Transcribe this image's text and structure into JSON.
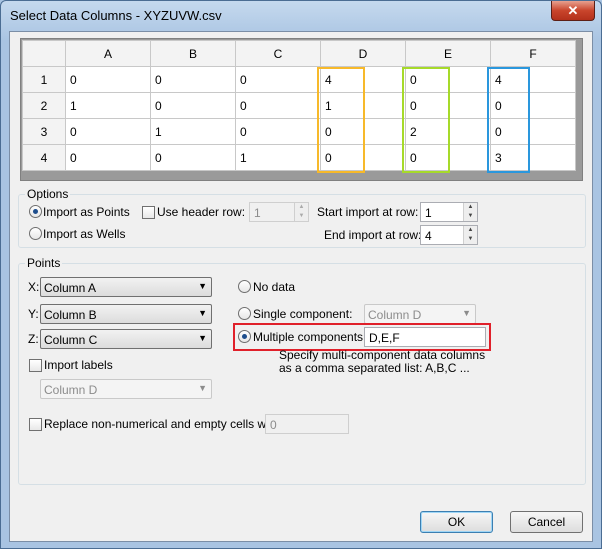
{
  "window": {
    "title": "Select Data Columns - XYZUVW.csv",
    "close_label": "✕"
  },
  "grid": {
    "columns": [
      "A",
      "B",
      "C",
      "D",
      "E",
      "F"
    ],
    "rows": [
      {
        "label": "1",
        "cells": [
          "0",
          "0",
          "0",
          "4",
          "0",
          "4"
        ]
      },
      {
        "label": "2",
        "cells": [
          "1",
          "0",
          "0",
          "1",
          "0",
          "0"
        ]
      },
      {
        "label": "3",
        "cells": [
          "0",
          "1",
          "0",
          "0",
          "2",
          "0"
        ]
      },
      {
        "label": "4",
        "cells": [
          "0",
          "0",
          "1",
          "0",
          "0",
          "3"
        ]
      }
    ],
    "highlight_colors": {
      "D": "#f7b92a",
      "E": "#a6da2a",
      "F": "#2a97dd"
    }
  },
  "options": {
    "group_label": "Options",
    "import_as_points": "Import as Points",
    "import_as_wells": "Import as Wells",
    "use_header_row": "Use header row:",
    "header_row_value": "1",
    "start_import_label": "Start import at row:",
    "start_import_value": "1",
    "end_import_label": "End import at row:",
    "end_import_value": "4"
  },
  "points": {
    "group_label": "Points",
    "x_label": "X:",
    "x_value": "Column A",
    "y_label": "Y:",
    "y_value": "Column B",
    "z_label": "Z:",
    "z_value": "Column C",
    "no_data": "No data",
    "single_component": "Single component:",
    "single_component_value": "Column D",
    "multiple_components": "Multiple components:",
    "multiple_components_value": "D,E,F",
    "hint": "Specify multi-component data columns as a comma separated list: A,B,C ...",
    "import_labels": "Import labels",
    "labels_value": "Column D",
    "replace_label": "Replace non-numerical and empty cells with:",
    "replace_value": "0",
    "highlight_color": "#e0202a"
  },
  "buttons": {
    "ok": "OK",
    "cancel": "Cancel"
  }
}
